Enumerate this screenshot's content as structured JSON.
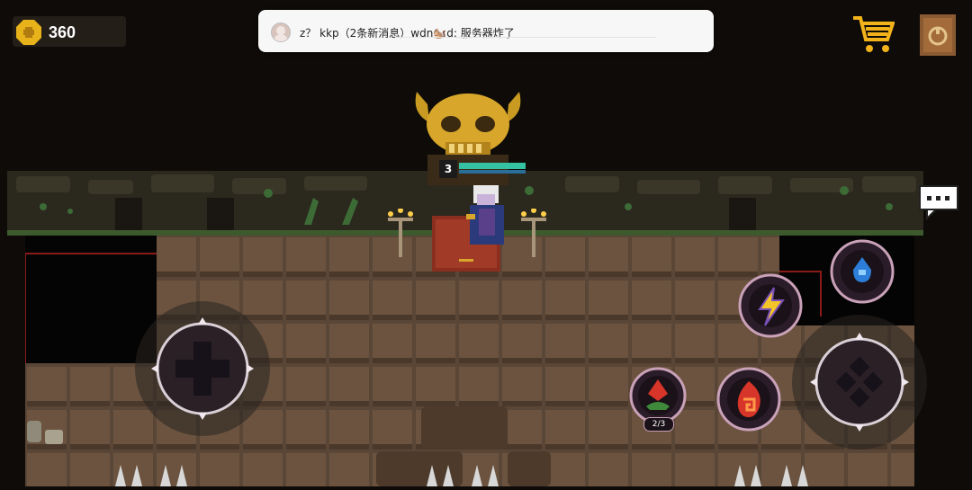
{
  "hud": {
    "coin_count": "360"
  },
  "notification": {
    "message": "z？ kkp（2条新消息）wdn🐿️d: 服务器炸了"
  },
  "player": {
    "level": "3"
  },
  "skills": {
    "potion_count": "2/3"
  },
  "colors": {
    "gold": "#e8b21a",
    "health": "#35c2a2",
    "floor": "#5a4636",
    "wall": "#2c2a20"
  },
  "icons": [
    "coin-icon",
    "shopping-cart-icon",
    "journal-book-icon",
    "chat-bubble-icon",
    "lightning-icon",
    "water-drop-icon",
    "fire-rune-icon",
    "potion-plant-icon"
  ]
}
